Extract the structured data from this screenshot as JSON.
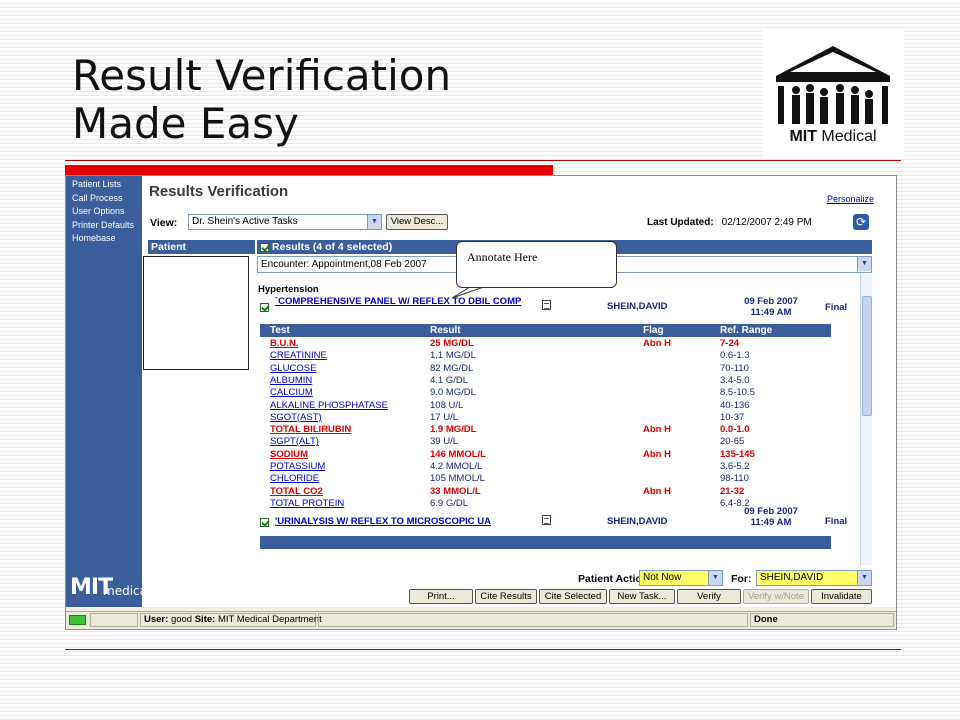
{
  "slide": {
    "title_line1": "Result Verification",
    "title_line2": "Made Easy",
    "logo_text_bold": "MIT",
    "logo_text_rest": " Medical"
  },
  "app": {
    "nav": {
      "items": [
        "Patient Lists",
        "Call Process",
        "User Options",
        "Printer Defaults",
        "Homebase"
      ],
      "logo_big": "MIT",
      "logo_small": "medical"
    },
    "title": "Results Verification",
    "personalize": "Personalize",
    "view_label": "View:",
    "view_value": "Dr. Shein's Active Tasks",
    "view_desc_button": "View Desc...",
    "last_updated_label": "Last Updated:",
    "last_updated_value": "02/12/2007 2:49 PM",
    "patient_header": "Patient",
    "results_header": "Results (4 of 4 selected)",
    "encounter": "Encounter: Appointment,08 Feb 2007",
    "group": "Hypertension",
    "panels": [
      {
        "name": "`COMPREHENSIVE PANEL W/ REFLEX TO DBIL COMP",
        "doctor": "SHEIN,DAVID",
        "date": "09 Feb 2007",
        "time": "11:49 AM",
        "status": "Final"
      },
      {
        "name": "'URINALYSIS W/ REFLEX TO MICROSCOPIC UA",
        "doctor": "SHEIN,DAVID",
        "date": "09 Feb 2007",
        "time": "11:49 AM",
        "status": "Final"
      }
    ],
    "columns": {
      "test": "Test",
      "result": "Result",
      "flag": "Flag",
      "range": "Ref. Range"
    },
    "rows": [
      {
        "test": "B.U.N.",
        "result": "25 MG/DL",
        "flag": "Abn H",
        "range": "7-24"
      },
      {
        "test": "CREATININE",
        "result": "1.1 MG/DL",
        "flag": "",
        "range": "0.6-1.3"
      },
      {
        "test": "GLUCOSE",
        "result": "82 MG/DL",
        "flag": "",
        "range": "70-110"
      },
      {
        "test": "ALBUMIN",
        "result": "4.1 G/DL",
        "flag": "",
        "range": "3.4-5.0"
      },
      {
        "test": "CALCIUM",
        "result": "9.0 MG/DL",
        "flag": "",
        "range": "8.5-10.5"
      },
      {
        "test": "ALKALINE PHOSPHATASE",
        "result": "108 U/L",
        "flag": "",
        "range": "40-136"
      },
      {
        "test": "SGOT(AST)",
        "result": "17 U/L",
        "flag": "",
        "range": "10-37"
      },
      {
        "test": "TOTAL BILIRUBIN",
        "result": "1.9 MG/DL",
        "flag": "Abn H",
        "range": "0.0-1.0"
      },
      {
        "test": "SGPT(ALT)",
        "result": "39 U/L",
        "flag": "",
        "range": "20-65"
      },
      {
        "test": "SODIUM",
        "result": "146 MMOL/L",
        "flag": "Abn H",
        "range": "135-145"
      },
      {
        "test": "POTASSIUM",
        "result": "4.2 MMOL/L",
        "flag": "",
        "range": "3.6-5.2"
      },
      {
        "test": "CHLORIDE",
        "result": "105 MMOL/L",
        "flag": "",
        "range": "98-110"
      },
      {
        "test": "TOTAL CO2",
        "result": "33 MMOL/L",
        "flag": "Abn H",
        "range": "21-32"
      },
      {
        "test": "TOTAL PROTEIN",
        "result": "6.9 G/DL",
        "flag": "",
        "range": "6.4-8.2"
      }
    ],
    "bottom": {
      "patient_action_label": "Patient Action:",
      "patient_action_value": "Not Now",
      "for_label": "For:",
      "for_value": "SHEIN,DAVID",
      "buttons": [
        "Print...",
        "Cite Results",
        "Cite Selected",
        "New Task...",
        "Verify",
        "Verify w/Note",
        "Invalidate"
      ]
    },
    "status": {
      "user_label": "User:",
      "user": "good",
      "site_label": "Site:",
      "site": "MIT Medical Department",
      "done": "Done"
    }
  },
  "callout": "Annotate Here",
  "colors": {
    "nav_blue": "#3b5d9c",
    "abnormal_red": "#e00000",
    "highlight_yellow": "#ffff66",
    "rule_red": "#e60000"
  }
}
